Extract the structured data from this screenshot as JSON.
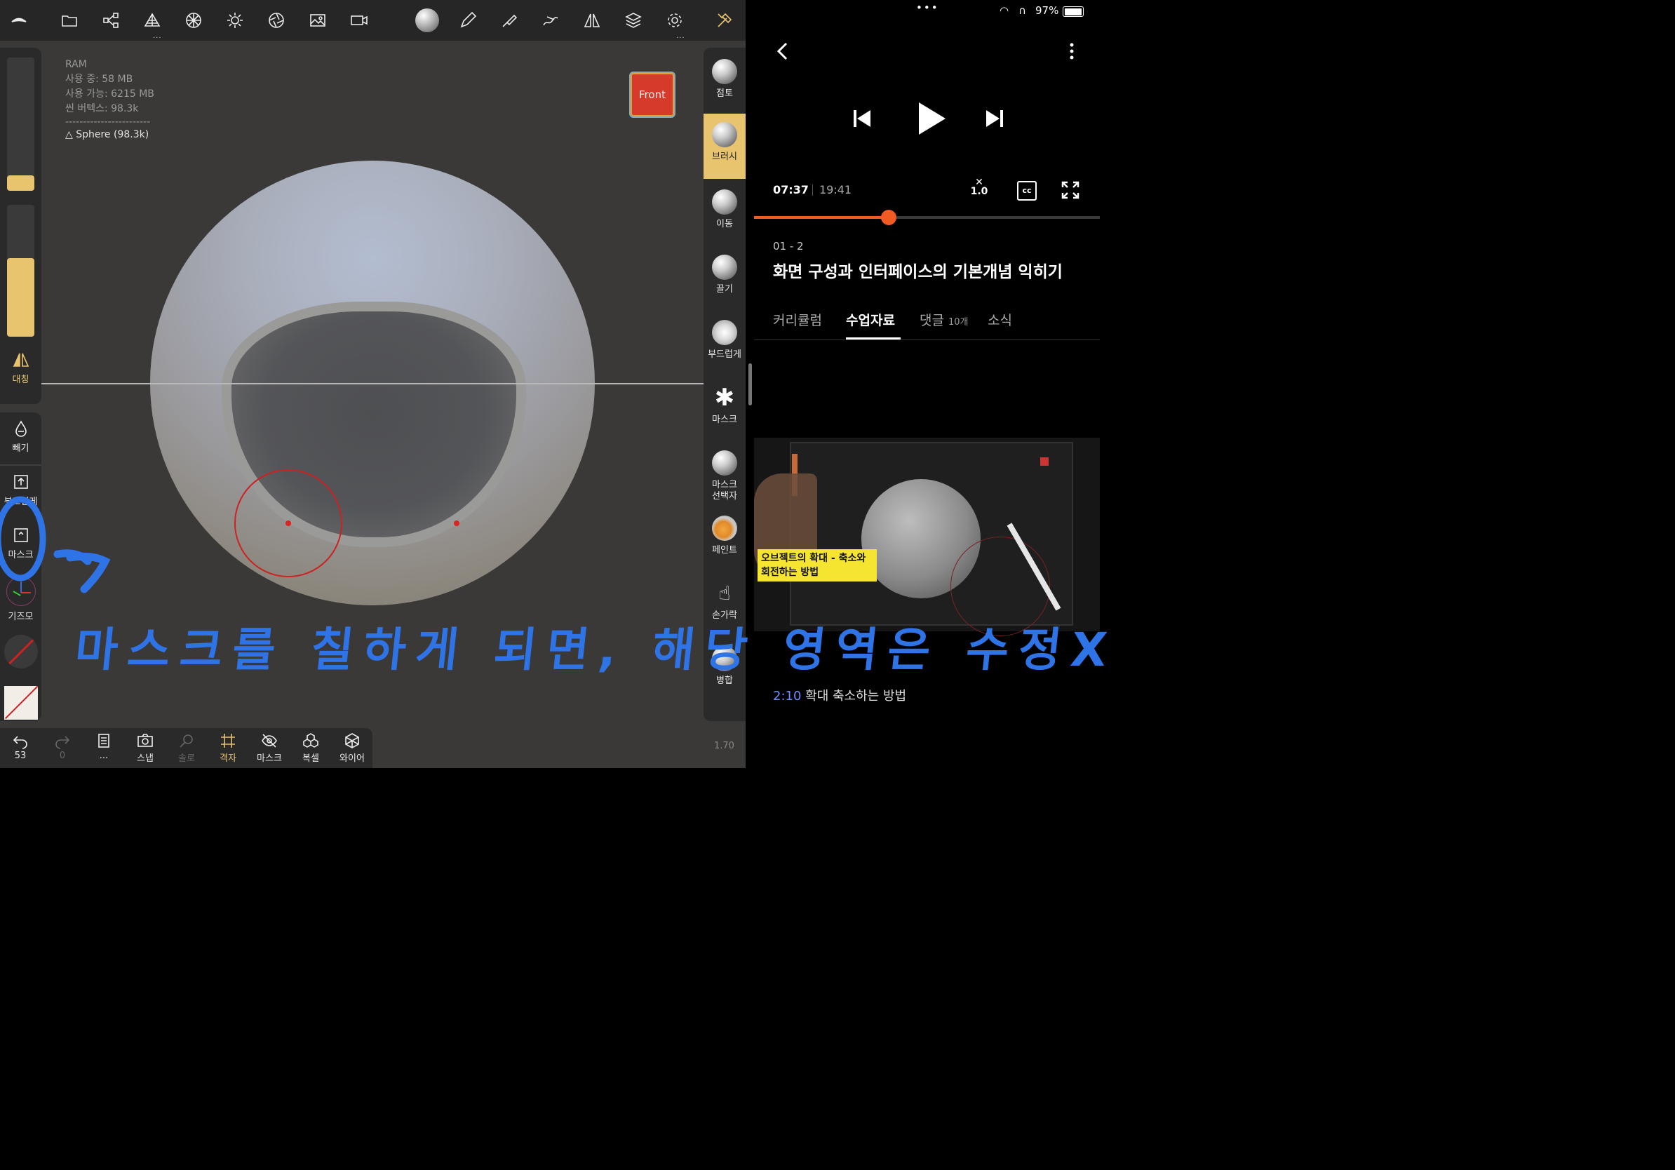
{
  "sculpt": {
    "toolbar_icons": [
      "nomad-logo-icon",
      "folder-icon",
      "scene-graph-icon",
      "topology-icon",
      "material-sphere-icon",
      "light-icon",
      "camera-lens-icon",
      "image-icon",
      "video-camera-icon",
      "material-ball-icon",
      "pencil-icon",
      "brush-icon",
      "stroke-icon",
      "symmetry-icon",
      "layers-icon",
      "settings-icon",
      "tools-icon"
    ],
    "more": "...",
    "stats": {
      "ram_label": "RAM",
      "used": "사용 중: 58 MB",
      "available": "사용 가능: 6215 MB",
      "scene_vertices": "씬 버텍스: 98.3k",
      "divider": "------------------------",
      "mesh": "Sphere (98.3k)"
    },
    "front_label": "Front",
    "left_panel": {
      "symmetry": "대칭",
      "subtract": "빼기",
      "smooth": "부드럽게",
      "mask": "마스크",
      "gizmo": "기즈모"
    },
    "tools": [
      "점토",
      "브러시",
      "이동",
      "끌기",
      "부드럽게",
      "마스크",
      "마스크\n선택자",
      "페인트",
      "손가락",
      "병합"
    ],
    "active_tool": "브러시",
    "bottom": {
      "undo_count": "53",
      "redo_count": "0",
      "more": "...",
      "snap": "스냅",
      "solo": "솔로",
      "grid": "격자",
      "mask": "마스크",
      "voxel": "복셀",
      "wire": "와이어"
    },
    "version": "1.70",
    "colors": {
      "accent": "#e8c46f",
      "front_red": "#d63a2a",
      "brush_ring": "#cc2222"
    }
  },
  "player": {
    "status": {
      "dots": "•••",
      "battery": "97%"
    },
    "current_time": "07:37",
    "duration": "19:41",
    "progress": 0.39,
    "speed": "1.0",
    "cc": "cc",
    "lesson_number": "01 - 2",
    "lesson_title": "화면 구성과 인터페이스의 기본개념 익히기",
    "tabs": [
      {
        "label": "커리큘럼",
        "count": ""
      },
      {
        "label": "수업자료",
        "count": ""
      },
      {
        "label": "댓글",
        "count": "10개"
      },
      {
        "label": "소식",
        "count": ""
      }
    ],
    "active_tab": "수업자료",
    "thumbnail_caption": "오브젝트의 확대 - 축소와 회전하는 방법",
    "chapter": {
      "time": "2:10",
      "title": "확대 축소하는 방법"
    },
    "colors": {
      "progress": "#f15a22",
      "link": "#6e8cff",
      "caption_bg": "#f5e531"
    }
  },
  "annotation": {
    "text": "마스크를 칠하게 되면, 해당 영역은 수정X",
    "arrow": "->",
    "color": "#2f74e6"
  }
}
